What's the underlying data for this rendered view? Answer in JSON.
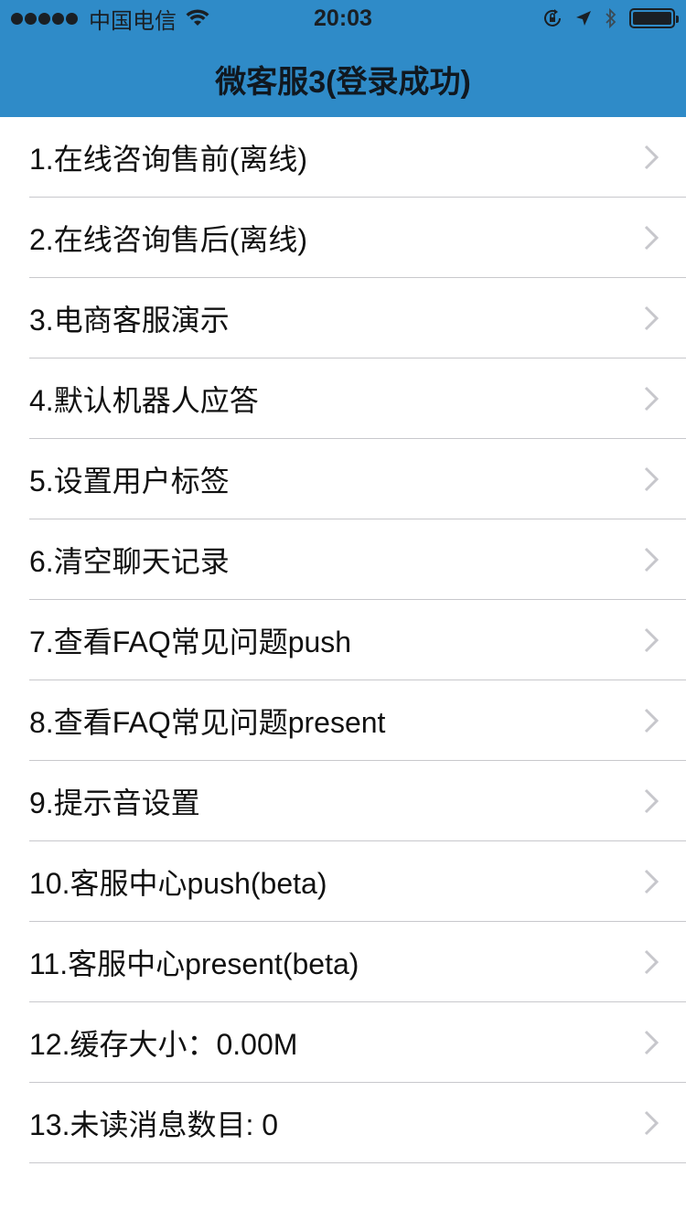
{
  "status_bar": {
    "carrier": "中国电信",
    "time": "20:03"
  },
  "nav": {
    "title": "微客服3(登录成功)"
  },
  "colors": {
    "nav_background": "#2f8bc8",
    "separator": "#c8c8cc",
    "chevron": "#c7c7cc"
  },
  "menu": {
    "items": [
      {
        "label": "1.在线咨询售前(离线)"
      },
      {
        "label": "2.在线咨询售后(离线)"
      },
      {
        "label": "3.电商客服演示"
      },
      {
        "label": "4.默认机器人应答"
      },
      {
        "label": "5.设置用户标签"
      },
      {
        "label": "6.清空聊天记录"
      },
      {
        "label": "7.查看FAQ常见问题push"
      },
      {
        "label": "8.查看FAQ常见问题present"
      },
      {
        "label": "9.提示音设置"
      },
      {
        "label": "10.客服中心push(beta)"
      },
      {
        "label": "11.客服中心present(beta)"
      },
      {
        "label": "12.缓存大小：0.00M"
      },
      {
        "label": "13.未读消息数目: 0"
      }
    ]
  }
}
